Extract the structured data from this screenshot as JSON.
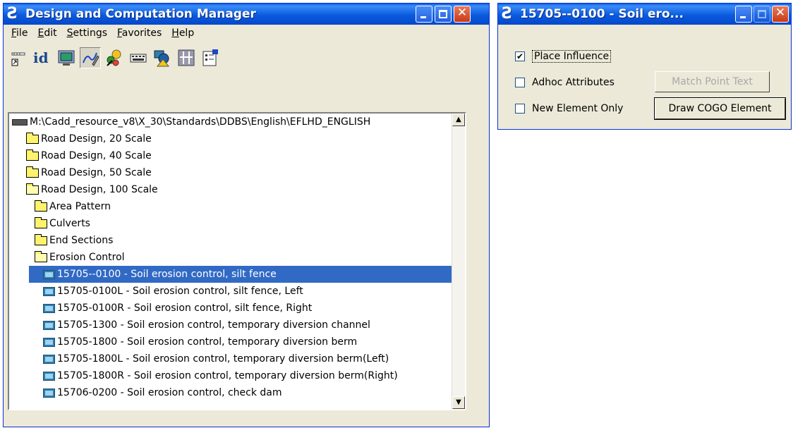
{
  "main_window": {
    "title": "Design and Computation Manager",
    "menu": [
      "File",
      "Edit",
      "Settings",
      "Favorites",
      "Help"
    ],
    "toolbar_icons": [
      "tag-icon",
      "id-icon",
      "monitor-icon",
      "pen-icon",
      "palette-icon",
      "keyboard-icon",
      "shapes-icon",
      "compute-icon",
      "properties-icon"
    ],
    "tree": {
      "root": "M:\\Cadd_resource_v8\\X_30\\Standards\\DDBS\\English\\EFLHD_ENGLISH",
      "items": [
        {
          "label": "Road Design, 20 Scale",
          "type": "folder"
        },
        {
          "label": "Road Design, 40 Scale",
          "type": "folder"
        },
        {
          "label": "Road Design, 50 Scale",
          "type": "folder"
        },
        {
          "label": "Road Design, 100 Scale",
          "type": "folder-open"
        },
        {
          "label": "Area Pattern",
          "type": "folder"
        },
        {
          "label": "Culverts",
          "type": "folder"
        },
        {
          "label": "End Sections",
          "type": "folder"
        },
        {
          "label": "Erosion Control",
          "type": "folder-open"
        },
        {
          "label": "15705--0100 - Soil erosion control, silt fence",
          "type": "item"
        },
        {
          "label": "15705-0100L - Soil erosion control, silt fence, Left",
          "type": "item"
        },
        {
          "label": "15705-0100R - Soil erosion control, silt fence, Right",
          "type": "item"
        },
        {
          "label": "15705-1300 - Soil erosion control, temporary diversion channel",
          "type": "item"
        },
        {
          "label": "15705-1800 - Soil erosion control, temporary diversion berm",
          "type": "item"
        },
        {
          "label": "15705-1800L - Soil erosion control, temporary diversion berm(Left)",
          "type": "item"
        },
        {
          "label": "15705-1800R - Soil erosion control, temporary diversion berm(Right)",
          "type": "item"
        },
        {
          "label": "15706-0200 - Soil erosion control, check dam",
          "type": "item"
        }
      ]
    }
  },
  "dialog": {
    "title": "15705--0100 - Soil ero...",
    "place_influence": "Place Influence",
    "adhoc_attributes": "Adhoc Attributes",
    "new_element_only": "New Element Only",
    "match_point_text": "Match Point Text",
    "draw_cogo_element": "Draw COGO Element",
    "checked_mark": "✔"
  },
  "colors": {
    "title_blue": "#0a5be0",
    "selection": "#316ac5",
    "window_face": "#ece9d8"
  }
}
